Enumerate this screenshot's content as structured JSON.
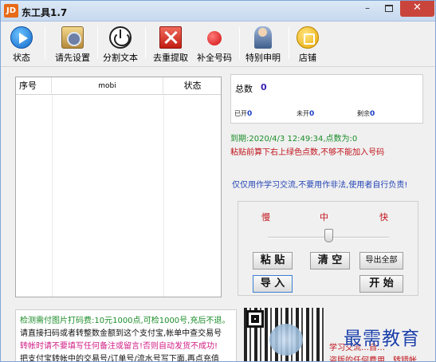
{
  "window": {
    "app_icon": "JD",
    "title": "东工具1.7",
    "controls": {
      "minimize": "–",
      "close": "✕"
    }
  },
  "toolbar": {
    "items": [
      {
        "label": "状态",
        "icon": "play-circle-icon"
      },
      {
        "label": "请先设置",
        "icon": "settings-book-icon"
      },
      {
        "label": "分割文本",
        "icon": "power-icon"
      },
      {
        "label": "去重提取",
        "icon": "red-x-icon"
      },
      {
        "label": "补全号码",
        "icon": "red-dot-icon"
      },
      {
        "label": "特别申明",
        "icon": "person-icon"
      },
      {
        "label": "店铺",
        "icon": "shop-coin-icon"
      }
    ]
  },
  "list": {
    "columns": [
      "序号",
      "mobi",
      "状态"
    ],
    "rows": []
  },
  "stats": {
    "total_label": "总数",
    "total_value": "0",
    "done_label": "已开",
    "done_value": "0",
    "pending_label": "未开",
    "pending_value": "0",
    "remain_label": "剩余",
    "remain_value": "0"
  },
  "messages": {
    "expire": "到期:2020/4/3 12:49:34,点数为:0",
    "hint": "粘贴前算下右上绿色点数,不够不能加入号码",
    "disclaimer": "仅仅用作学习交流,不要用作非法,使用者自行负责!"
  },
  "speed": {
    "slow": "慢",
    "mid": "中",
    "fast": "快",
    "level": 0.5
  },
  "buttons": {
    "paste": "粘 贴",
    "clear": "清 空",
    "export": "导出全部",
    "import": "导 入",
    "start": "开 始"
  },
  "notice": {
    "line1": "检测需付图片打码费:10元1000点,可检1000号,充后不退。",
    "line2": "请直接扫码或者转整数金额到这个支付宝,帐单中查交易号",
    "line3": "转帐时请不要填写任何备注或留言!否则自动发货不成功!",
    "line4": "把支付宝转帐中的交易号/订单号/流水号写下面,再点充值"
  },
  "right_bottom": {
    "line1": "学习交流…自…",
    "line2": "盗版的任何费用、转错帐"
  },
  "watermark": "最需教育",
  "colors": {
    "close_button": "#c9453b",
    "title_bar": "#dbe8f6",
    "green_text": "#1c8d2a",
    "red_text": "#c0131b",
    "blue_text": "#2444b5"
  }
}
